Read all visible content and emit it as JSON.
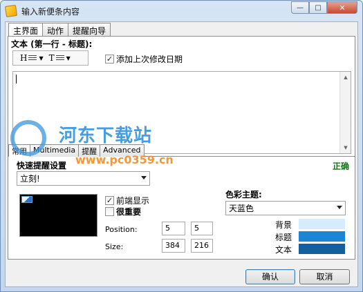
{
  "window": {
    "title": "输入新便条内容",
    "buttons": {
      "minimize": "—",
      "maximize": "□",
      "close": "✕"
    }
  },
  "main_tabs": [
    {
      "label": "主界面",
      "active": true
    },
    {
      "label": "动作",
      "active": false
    },
    {
      "label": "提醒向导",
      "active": false
    }
  ],
  "editor": {
    "text_label": "文本 (第一行 - 标题):",
    "toolbar": {
      "heading_btn": "H",
      "text_btn": "T"
    },
    "add_date_checkbox": {
      "label": "添加上次修改日期",
      "checked": true
    },
    "content": ""
  },
  "bottom_tabs": [
    {
      "label": "常用",
      "active": true
    },
    {
      "label": "Multimedia",
      "active": false
    },
    {
      "label": "提醒",
      "active": false
    },
    {
      "label": "Advanced",
      "active": false
    }
  ],
  "quick_reminder": {
    "label": "快速提醒设置",
    "status": "正确",
    "selected": "立刻!"
  },
  "display": {
    "topmost": {
      "label": "前端显示",
      "checked": true
    },
    "important": {
      "label": "很重要",
      "checked": false
    },
    "position_label": "Position:",
    "position_x": "5",
    "position_y": "5",
    "size_label": "Size:",
    "size_w": "384",
    "size_h": "216"
  },
  "color_theme": {
    "label": "色彩主题:",
    "selected": "天蓝色",
    "rows": [
      {
        "label": "背景",
        "color": "#d4ecfb"
      },
      {
        "label": "标题",
        "color": "#1b86d6"
      },
      {
        "label": "文本",
        "color": "#14609f"
      }
    ]
  },
  "buttons": {
    "ok": "确认",
    "cancel": "取消"
  },
  "watermark": {
    "main": "河东下载站",
    "url": "www.pc0359.cn"
  }
}
